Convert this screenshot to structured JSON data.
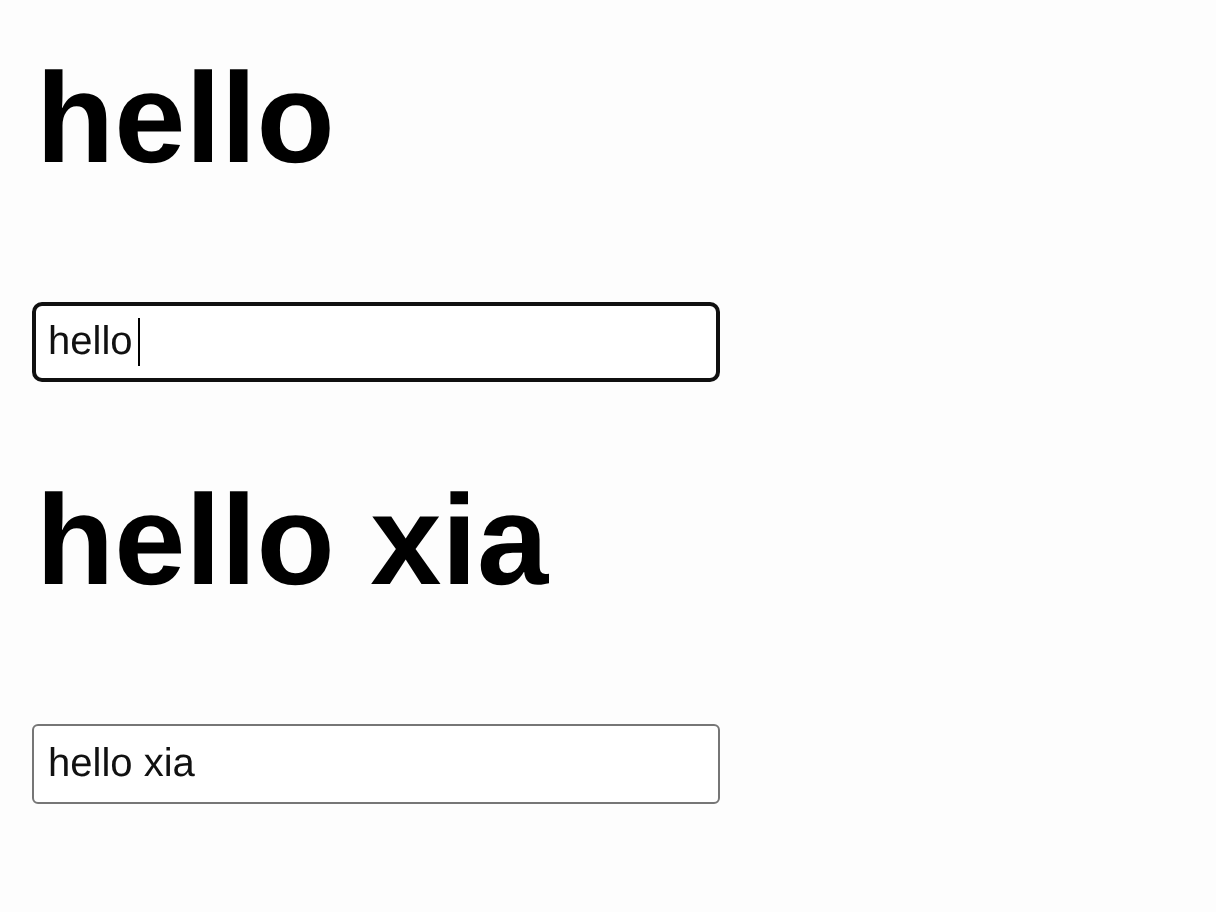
{
  "sections": [
    {
      "heading": "hello",
      "input": {
        "value": "hello",
        "focused": true
      }
    },
    {
      "heading": "hello xia",
      "input": {
        "value": "hello xia",
        "focused": false
      }
    }
  ]
}
